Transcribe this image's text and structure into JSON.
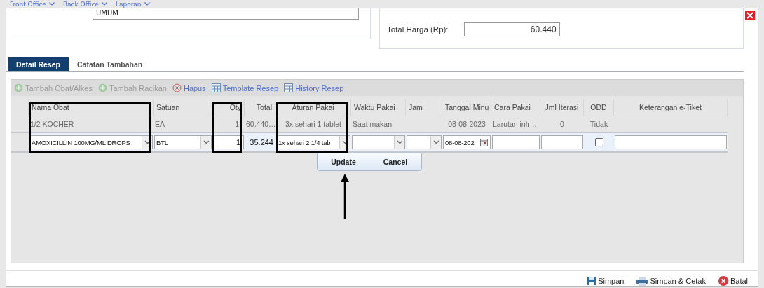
{
  "nav": [
    {
      "label": "Front Office"
    },
    {
      "label": "Back Office"
    },
    {
      "label": "Laporan"
    }
  ],
  "form": {
    "field_value": "UMUM",
    "total_label": "Total Harga (Rp):",
    "total_value": "60.440"
  },
  "tabs": [
    {
      "label": "Detail Resep",
      "selected": true
    },
    {
      "label": "Catatan Tambahan",
      "selected": false
    }
  ],
  "toolbar": [
    {
      "kind": "add",
      "label": "Tambah Obat/Alkes",
      "disabled": true
    },
    {
      "kind": "add",
      "label": "Tambah Racikan",
      "disabled": true
    },
    {
      "kind": "delete",
      "label": "Hapus",
      "disabled": false
    },
    {
      "kind": "grid",
      "label": "Template Resep",
      "disabled": false
    },
    {
      "kind": "grid",
      "label": "History Resep",
      "disabled": false
    }
  ],
  "table": {
    "columns": [
      "Nama Obat",
      "Satuan",
      "Qty",
      "Total",
      "Aturan Pakai",
      "Waktu Pakai",
      "Jam",
      "Tanggal Minu",
      "Cara Pakai",
      "Jml Iterasi",
      "ODD",
      "Keterangan e-Tiket"
    ],
    "rows": [
      {
        "cells": [
          "1/2 KOCHER",
          "EA",
          "1",
          "60.440…",
          "3x sehari 1 tablet",
          "Saat makan",
          "",
          "08-08-2023",
          "Larutan inh…",
          "0",
          "Tidak",
          ""
        ]
      }
    ],
    "edit_row": [
      {
        "kind": "select",
        "value": "AMOXICILLIN 100MG/ML DROPS"
      },
      {
        "kind": "select",
        "value": "BTL"
      },
      {
        "kind": "input",
        "value": "1"
      },
      {
        "kind": "text",
        "value": "35.244"
      },
      {
        "kind": "select",
        "value": "1x sehari 2 1/4 tab"
      },
      {
        "kind": "select"
      },
      {
        "kind": "select"
      },
      {
        "kind": "date",
        "value": "08-08-202"
      },
      {
        "kind": "input"
      },
      {
        "kind": "input"
      },
      {
        "kind": "checkbox",
        "checked": false
      },
      {
        "kind": "input"
      }
    ],
    "popup_buttons": [
      "Update",
      "Cancel"
    ]
  },
  "footer_buttons": [
    {
      "kind": "save",
      "label": "Simpan"
    },
    {
      "kind": "print",
      "label": "Simpan & Cetak"
    },
    {
      "kind": "cancel",
      "label": "Batal"
    }
  ]
}
